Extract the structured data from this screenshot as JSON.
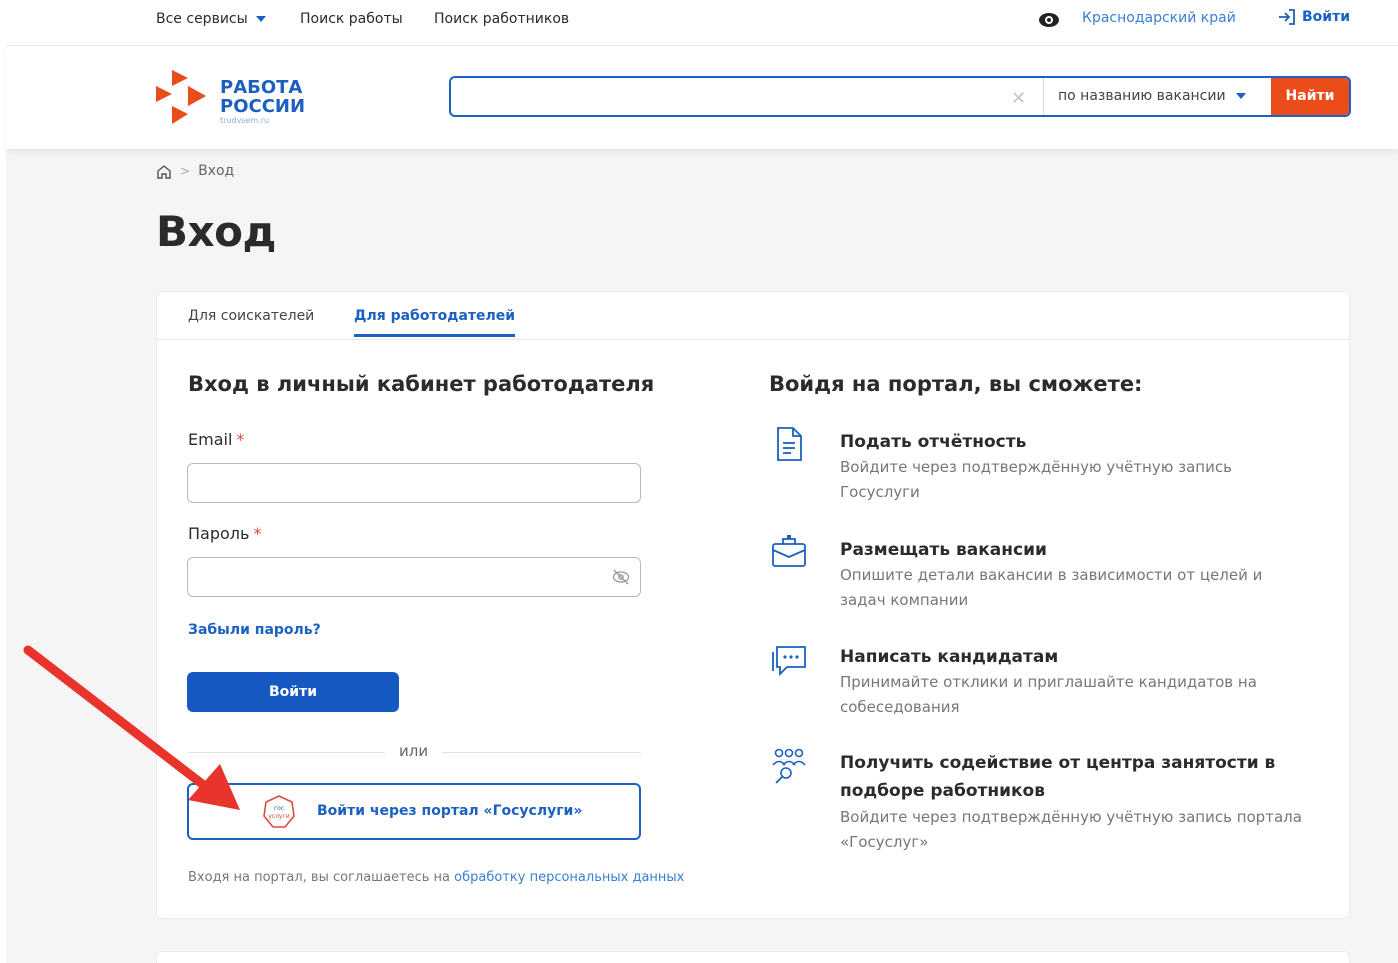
{
  "topbar": {
    "all_services": "Все сервисы",
    "job_search": "Поиск работы",
    "worker_search": "Поиск работников",
    "region": "Краснодарский край",
    "login": "Войти"
  },
  "header": {
    "logo_line1": "РАБОТА",
    "logo_line2": "РОССИИ",
    "logo_sub": "trudvsem.ru",
    "search": {
      "value": "",
      "placeholder": "",
      "mode": "по названию вакансии",
      "button": "Найти"
    }
  },
  "breadcrumb": {
    "current": "Вход"
  },
  "page_title": "Вход",
  "tabs": [
    {
      "label": "Для соискателей",
      "active": false
    },
    {
      "label": "Для работодателей",
      "active": true
    }
  ],
  "login_form": {
    "title": "Вход в личный кабинет работодателя",
    "email_label": "Email",
    "password_label": "Пароль",
    "required_mark": "*",
    "forgot": "Забыли пароль?",
    "submit": "Войти",
    "or": "или",
    "gosuslugi_button": "Войти через портал «Госуслуги»",
    "gosuslugi_logo_text": "гос услуги",
    "consent_text": "Входя на портал, вы соглашаетесь на",
    "consent_link": "обработку персональных данных"
  },
  "benefits": {
    "title": "Войдя на портал, вы сможете:",
    "items": [
      {
        "icon": "document-icon",
        "title": "Подать отчётность",
        "desc": "Войдите через подтверждённую учётную запись Госуслуги"
      },
      {
        "icon": "briefcase-icon",
        "title": "Размещать вакансии",
        "desc": "Опишите детали вакансии в зависимости от целей и задач компании"
      },
      {
        "icon": "chat-icon",
        "title": "Написать кандидатам",
        "desc": "Принимайте отклики и приглашайте кандидатов на собеседования"
      },
      {
        "icon": "people-search-icon",
        "title": "Получить содействие от центра занятости в подборе работников",
        "desc": "Войдите через подтверждённую учётную запись портала «Госуслуг»"
      }
    ]
  },
  "colors": {
    "primary": "#1a61c2",
    "accent": "#ea4d19",
    "annotation_arrow": "#e8342a"
  }
}
